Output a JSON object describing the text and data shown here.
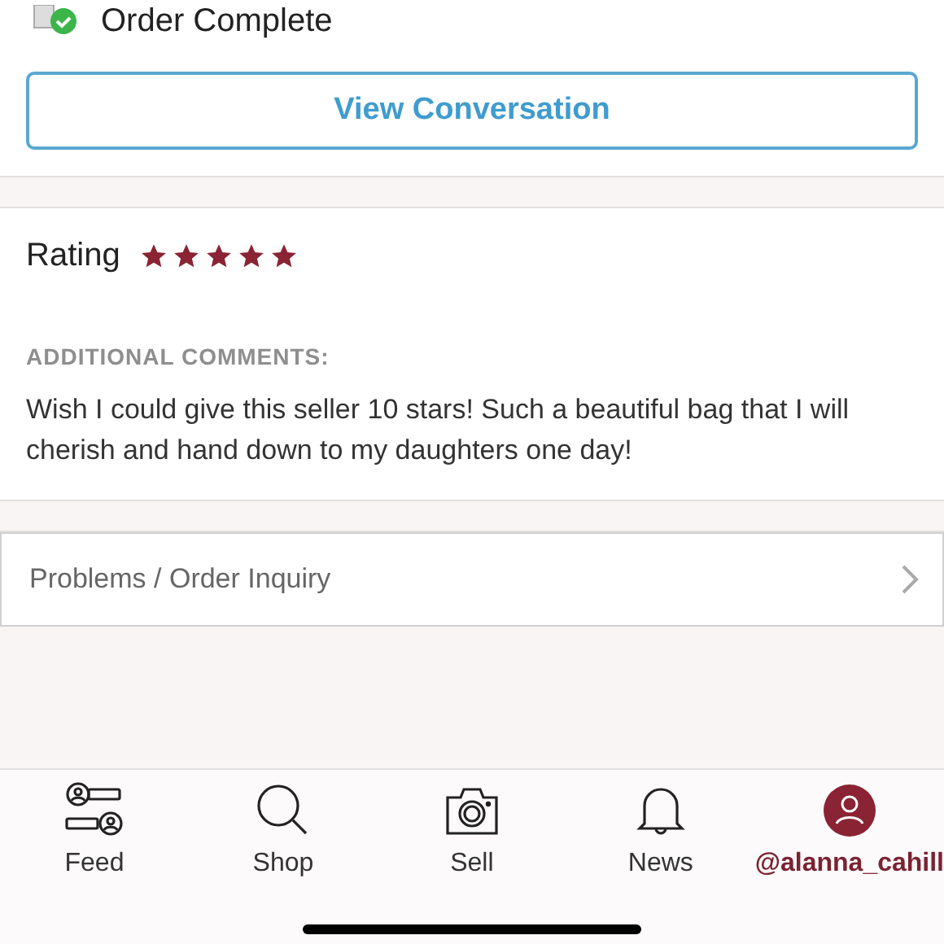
{
  "order_status": {
    "title": "Order Complete"
  },
  "view_conversation_button": {
    "label": "View Conversation"
  },
  "rating": {
    "label": "Rating",
    "stars": 5
  },
  "comments": {
    "heading": "ADDITIONAL COMMENTS:",
    "text": "Wish I could give this seller 10 stars! Such a beautiful bag that I will cherish and hand down to my daughters one day!"
  },
  "inquiry_link": {
    "label": "Problems / Order Inquiry"
  },
  "tab_bar": [
    {
      "kind": "feed",
      "label": "Feed",
      "selected": false
    },
    {
      "kind": "shop",
      "label": "Shop",
      "selected": false
    },
    {
      "kind": "sell",
      "label": "Sell",
      "selected": false
    },
    {
      "kind": "news",
      "label": "News",
      "selected": false
    },
    {
      "kind": "profile",
      "label": "@alanna_cahill",
      "selected": true
    }
  ]
}
